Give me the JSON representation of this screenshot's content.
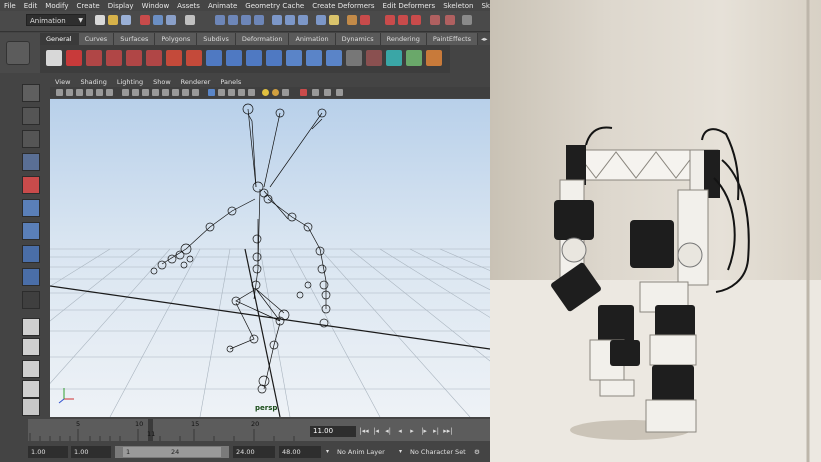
{
  "menubar": {
    "items": [
      "File",
      "Edit",
      "Modify",
      "Create",
      "Display",
      "Window",
      "Assets",
      "Animate",
      "Geometry Cache",
      "Create Deformers",
      "Edit Deformers",
      "Skeleton",
      "Skin"
    ]
  },
  "statusline": {
    "mode": "Animation"
  },
  "shelf": {
    "tabs": [
      "General",
      "Curves",
      "Surfaces",
      "Polygons",
      "Subdivs",
      "Deformation",
      "Animation",
      "Dynamics",
      "Rendering",
      "PaintEffects"
    ],
    "active_tab": "General"
  },
  "panel": {
    "menus": [
      "View",
      "Shading",
      "Lighting",
      "Show",
      "Renderer",
      "Panels"
    ],
    "camera_label": "persp"
  },
  "timeslider": {
    "ticks": [
      "5",
      "10",
      "15",
      "20"
    ],
    "current_marker": "11",
    "current_time": "11.00"
  },
  "playback": {
    "buttons": [
      "goto-start",
      "step-back-key",
      "step-back-frame",
      "play-backward",
      "play-forward",
      "step-forward-frame",
      "step-forward-key",
      "goto-end"
    ]
  },
  "range": {
    "start_time": "1.00",
    "playback_start": "1.00",
    "slider_start": "1",
    "slider_end": "24",
    "playback_end": "24.00",
    "end_time": "48.00",
    "anim_layer": "No Anim Layer",
    "character_set": "No Character Set"
  },
  "colors": {
    "viewport_top": "#b8d0ea",
    "viewport_bottom": "#eef2f6",
    "ui_gray": "#444444"
  }
}
